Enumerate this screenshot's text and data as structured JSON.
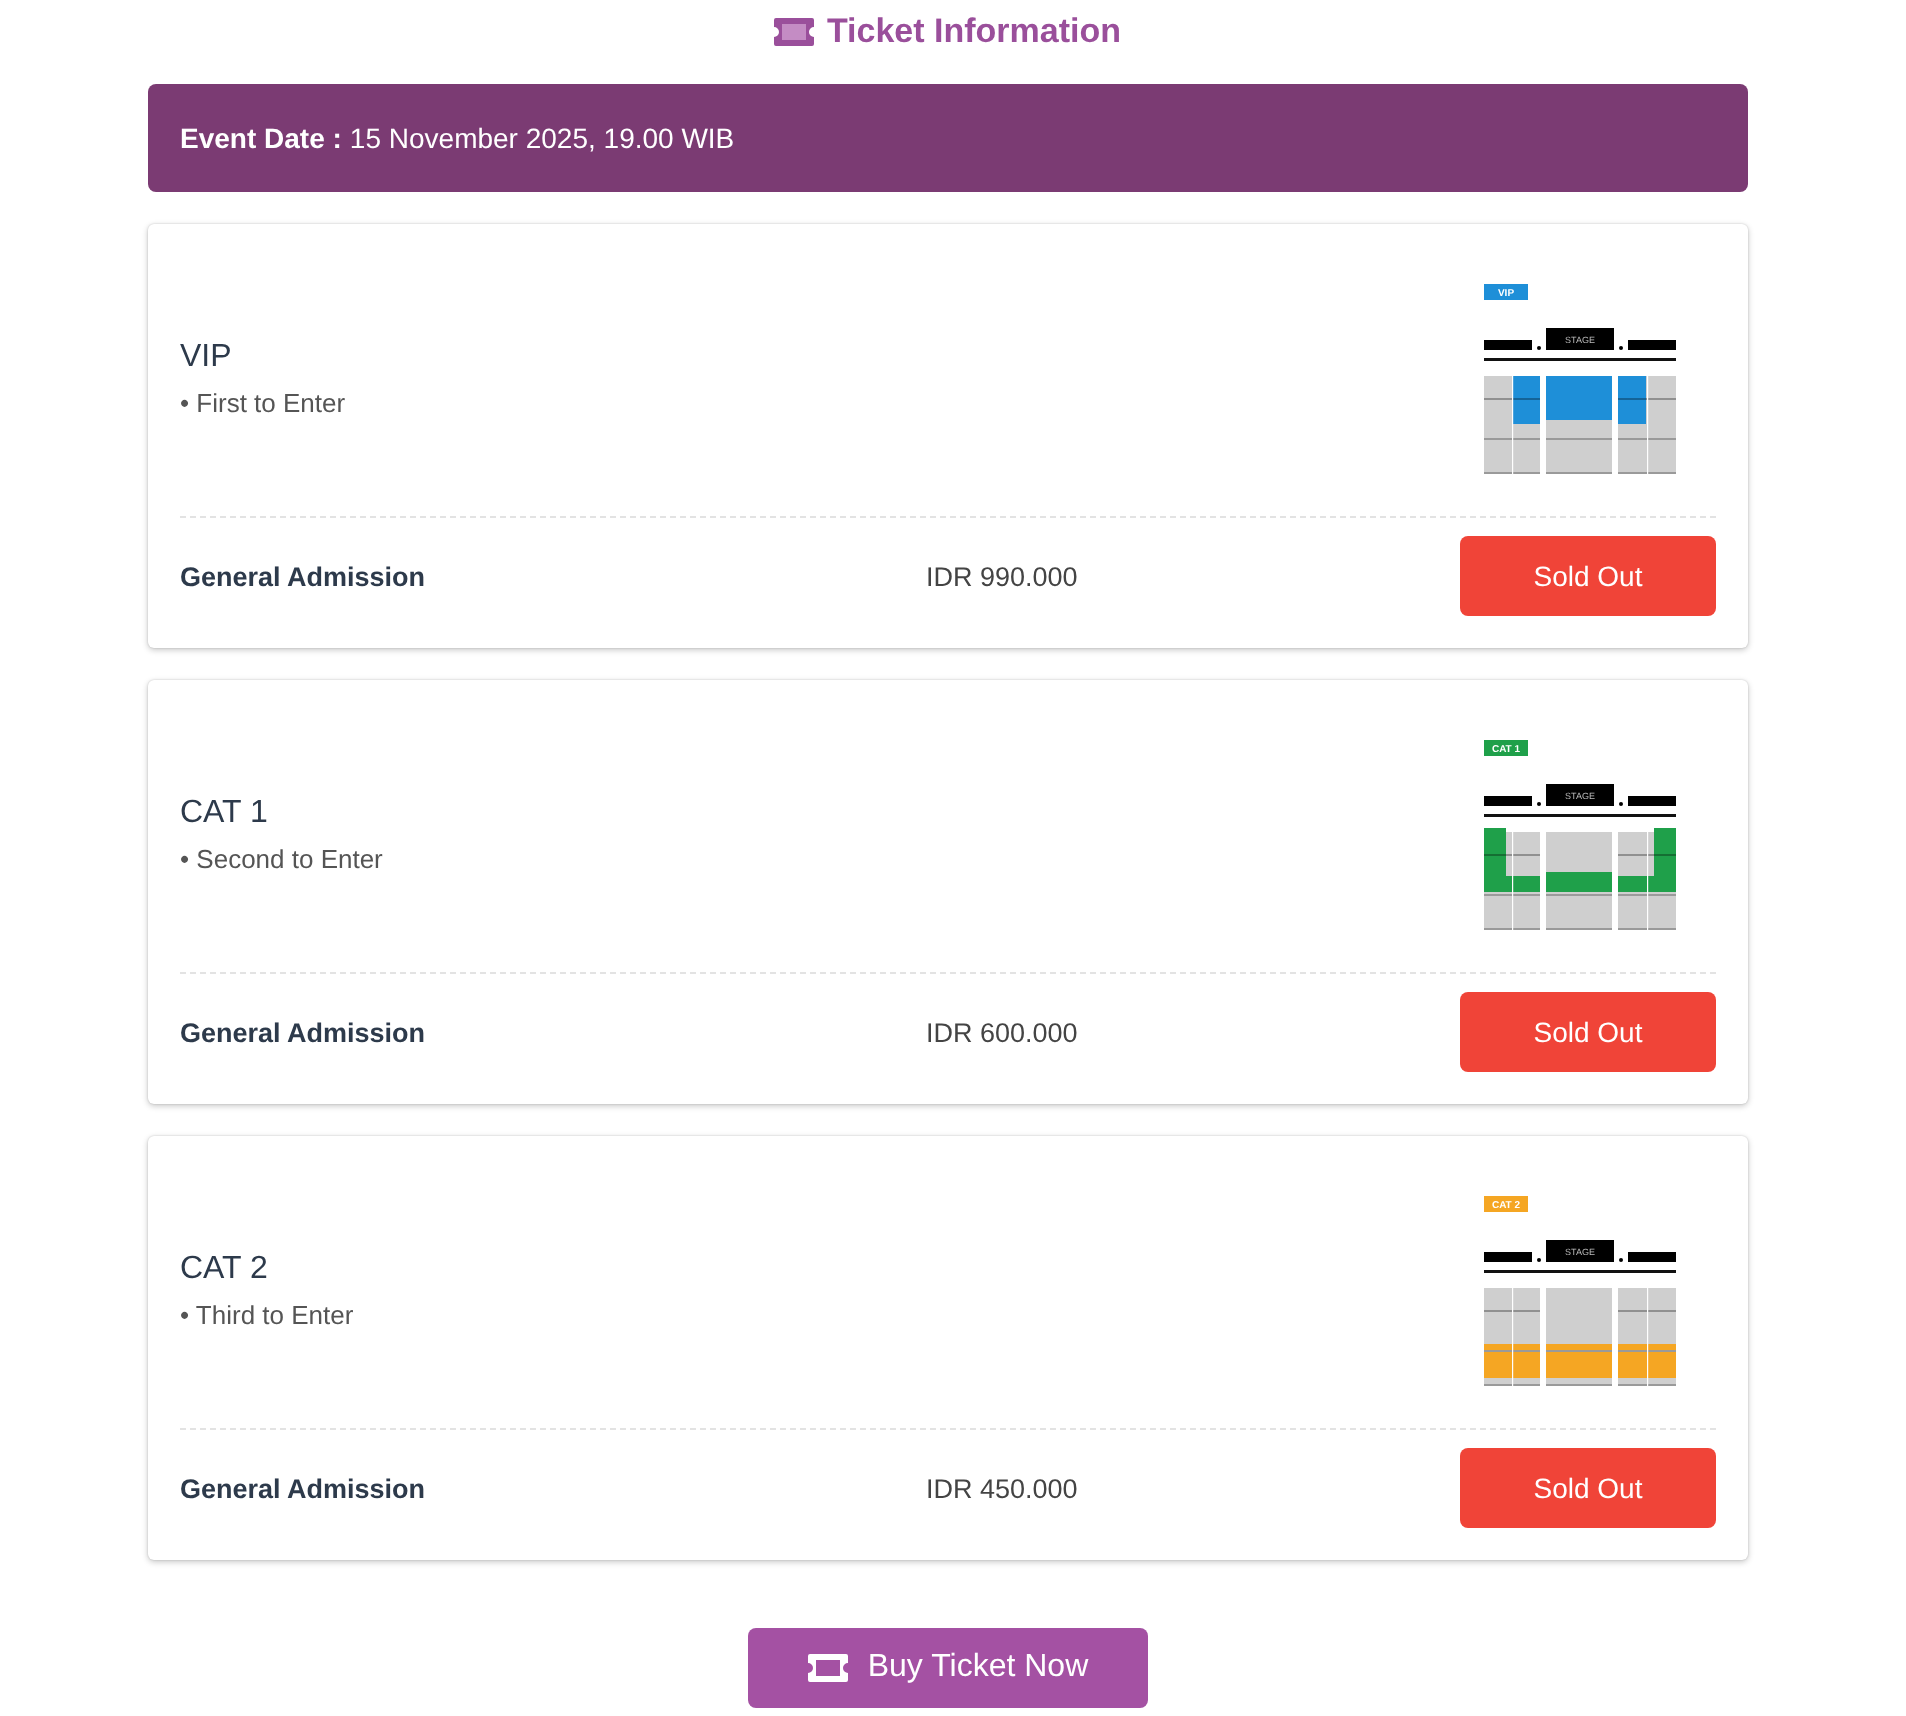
{
  "header": {
    "title": "Ticket Information"
  },
  "event": {
    "label": "Event Date :",
    "value": "15 November 2025, 19.00 WIB"
  },
  "tickets": [
    {
      "name": "VIP",
      "perks": [
        "• First to Enter"
      ],
      "seat_map": {
        "badge": "VIP",
        "stage": "STAGE",
        "kind": "front",
        "color": "#1e8fd8"
      },
      "admission": "General Admission",
      "price": "IDR 990.000",
      "button": "Sold Out"
    },
    {
      "name": "CAT 1",
      "perks": [
        "• Second to Enter"
      ],
      "seat_map": {
        "badge": "CAT 1",
        "stage": "STAGE",
        "kind": "middle",
        "color": "#1fa04a"
      },
      "admission": "General Admission",
      "price": "IDR 600.000",
      "button": "Sold Out"
    },
    {
      "name": "CAT 2",
      "perks": [
        "• Third to Enter"
      ],
      "seat_map": {
        "badge": "CAT 2",
        "stage": "STAGE",
        "kind": "back",
        "color": "#f5a623"
      },
      "admission": "General Admission",
      "price": "IDR 450.000",
      "button": "Sold Out"
    }
  ],
  "buy_button": {
    "label": "Buy Ticket Now"
  }
}
